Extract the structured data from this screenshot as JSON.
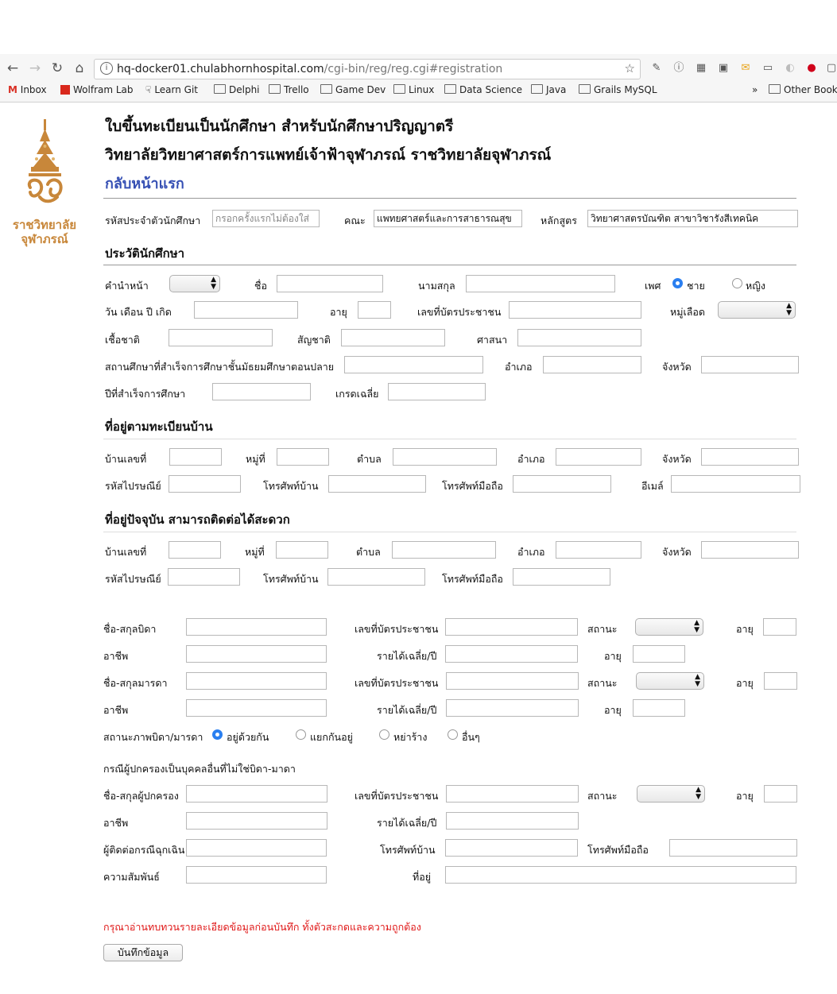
{
  "browser": {
    "url_host": "hq-docker01.chulabhornhospital.com",
    "url_path": "/cgi-bin/reg/reg.cgi#registration",
    "bookmarks": [
      "Inbox",
      "Wolfram Lab",
      "Learn Git",
      "Delphi",
      "Trello",
      "Game Dev",
      "Linux",
      "Data Science",
      "Java",
      "Grails MySQL"
    ],
    "more": "»",
    "other_bookmarks": "Other Book"
  },
  "logo": {
    "line1": "ราชวิทยาลัย",
    "line2": "จุฬาภรณ์"
  },
  "header": {
    "title1": "ใบขึ้นทะเบียนเป็นนักศึกษา สำหรับนักศึกษาปริญญาตรี",
    "title2": "วิทยาลัยวิทยาศาสตร์การแพทย์เจ้าฟ้าจุฬาภรณ์ ราชวิทยาลัยจุฬาภรณ์",
    "back_link": "กลับหน้าแรก"
  },
  "top_row": {
    "student_id_label": "รหัสประจำตัวนักศึกษา",
    "student_id_placeholder": "กรอกครั้งแรกไม่ต้องใส่",
    "faculty_label": "คณะ",
    "faculty_value": "แพทยศาสตร์และการสาธารณสุข",
    "program_label": "หลักสูตร",
    "program_value": "วิทยาศาสตรบัณฑิต สาขาวิชารังสีเทคนิค"
  },
  "profile": {
    "heading": "ประวัตินักศึกษา",
    "prefix": "คำนำหน้า",
    "firstname": "ชื่อ",
    "lastname": "นามสกุล",
    "gender": "เพศ",
    "male": "ชาย",
    "female": "หญิง",
    "birthdate": "วัน เดือน ปี เกิด",
    "age": "อายุ",
    "national_id": "เลขที่บัตรประชาชน",
    "blood": "หมู่เลือด",
    "race": "เชื้อชาติ",
    "nationality": "สัญชาติ",
    "religion": "ศาสนา",
    "school": "สถานศึกษาที่สำเร็จการศึกษาชั้นมัธยมศึกษาตอนปลาย",
    "district": "อำเภอ",
    "province": "จังหวัด",
    "grad_year": "ปีที่สำเร็จการศึกษา",
    "gpa": "เกรดเฉลี่ย"
  },
  "home_address": {
    "heading": "ที่อยู่ตามทะเบียนบ้าน",
    "house_no": "บ้านเลขที่",
    "moo": "หมู่ที่",
    "tambon": "ตำบล",
    "district": "อำเภอ",
    "province": "จังหวัด",
    "postcode": "รหัสไปรษณีย์",
    "home_phone": "โทรศัพท์บ้าน",
    "mobile": "โทรศัพท์มือถือ",
    "email": "อีเมล์"
  },
  "current_address": {
    "heading": "ที่อยู่ปัจจุบัน สามารถติดต่อได้สะดวก",
    "house_no": "บ้านเลขที่",
    "moo": "หมู่ที่",
    "tambon": "ตำบล",
    "district": "อำเภอ",
    "province": "จังหวัด",
    "postcode": "รหัสไปรษณีย์",
    "home_phone": "โทรศัพท์บ้าน",
    "mobile": "โทรศัพท์มือถือ"
  },
  "parents": {
    "father_name": "ชื่อ-สกุลบิดา",
    "national_id": "เลขที่บัตรประชาชน",
    "status": "สถานะ",
    "age": "อายุ",
    "occupation": "อาชีพ",
    "income": "รายได้เฉลี่ย/ปี",
    "mother_name": "ชื่อ-สกุลมารดา",
    "marital": "สถานะภาพบิดา/มารดา",
    "marital_options": [
      "อยู่ด้วยกัน",
      "แยกกันอยู่",
      "หย่าร้าง",
      "อื่นๆ"
    ]
  },
  "guardian": {
    "note": "กรณีผู้ปกครองเป็นบุคคลอื่นที่ไม่ใช่บิดา-มาดา",
    "name": "ชื่อ-สกุลผู้ปกครอง",
    "national_id": "เลขที่บัตรประชาชน",
    "status": "สถานะ",
    "age": "อายุ",
    "occupation": "อาชีพ",
    "income": "รายได้เฉลี่ย/ปี",
    "emergency": "ผู้ติดต่อกรณีฉุกเฉิน",
    "home_phone": "โทรศัพท์บ้าน",
    "mobile": "โทรศัพท์มือถือ",
    "relation": "ความสัมพันธ์",
    "address": "ที่อยู่"
  },
  "footer": {
    "warning": "กรุณาอ่านทบทวนรายละเอียดข้อมูลก่อนบันทึก ทั้งตัวสะกดและความถูกต้อง",
    "save": "บันทึกข้อมูล"
  },
  "colors": {
    "link": "#3650b4",
    "warning": "#e01818",
    "radio": "#2a7ff0",
    "logo": "#c8873a"
  }
}
